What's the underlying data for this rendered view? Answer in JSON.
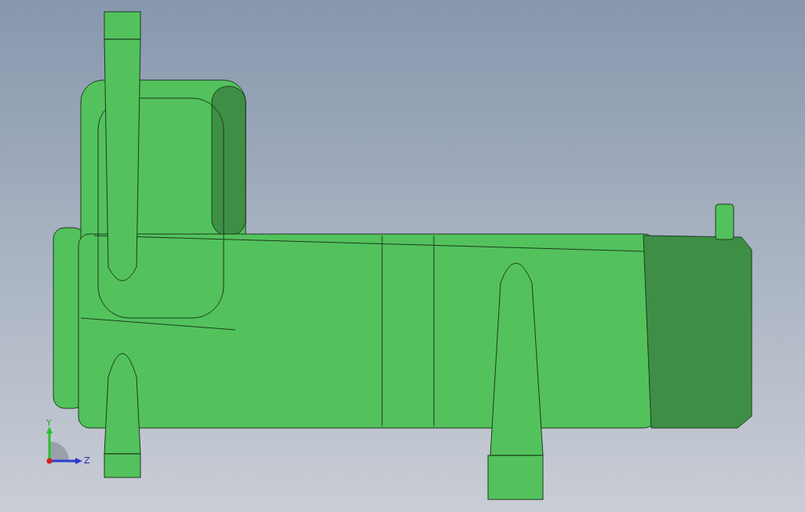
{
  "viewport": {
    "axes": [
      {
        "label": "Y"
      },
      {
        "label": "Z"
      }
    ]
  }
}
